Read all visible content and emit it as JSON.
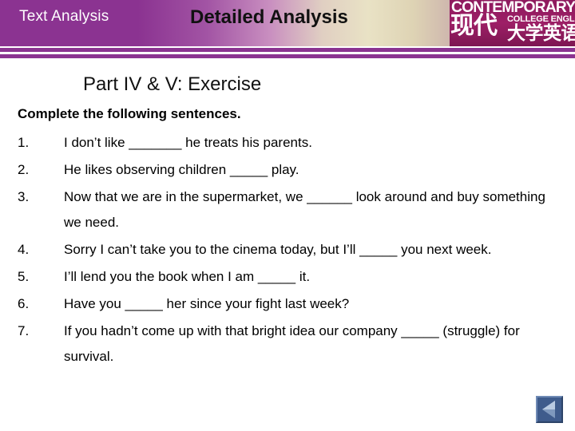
{
  "header": {
    "left_title": "Text Analysis",
    "center_title": "Detailed Analysis",
    "bar_color": "#8b3391",
    "logo": {
      "contemporary": "CONTEMPORARY",
      "college_english": "COLLEGE ENGLISH",
      "chinese_top": "现代",
      "chinese_bottom": "大学英语",
      "background_color": "#9d1f66"
    }
  },
  "content": {
    "slide_title": "Part IV & V:  Exercise",
    "instruction": "Complete the following sentences.",
    "items": [
      {
        "number": "1.",
        "text": "I don’t like _______ he treats his parents."
      },
      {
        "number": "2.",
        "text": "He likes observing children _____ play."
      },
      {
        "number": "3.",
        "text": "Now that we are in the supermarket, we ______ look around and buy something we need."
      },
      {
        "number": "4.",
        "text": "Sorry I can’t take you to the cinema today, but I’ll _____ you next week."
      },
      {
        "number": "5.",
        "text": "I’ll lend you the book when I am _____ it."
      },
      {
        "number": "6.",
        "text": "Have you _____ her since your  fight last week?"
      },
      {
        "number": "7.",
        "text": "If you hadn’t come up with that bright idea our company _____ (struggle) for survival."
      }
    ]
  },
  "navigation": {
    "back_button_label": "Back",
    "back_button_icon": "left-triangle-icon",
    "back_button_color": "#3f5c8c"
  }
}
